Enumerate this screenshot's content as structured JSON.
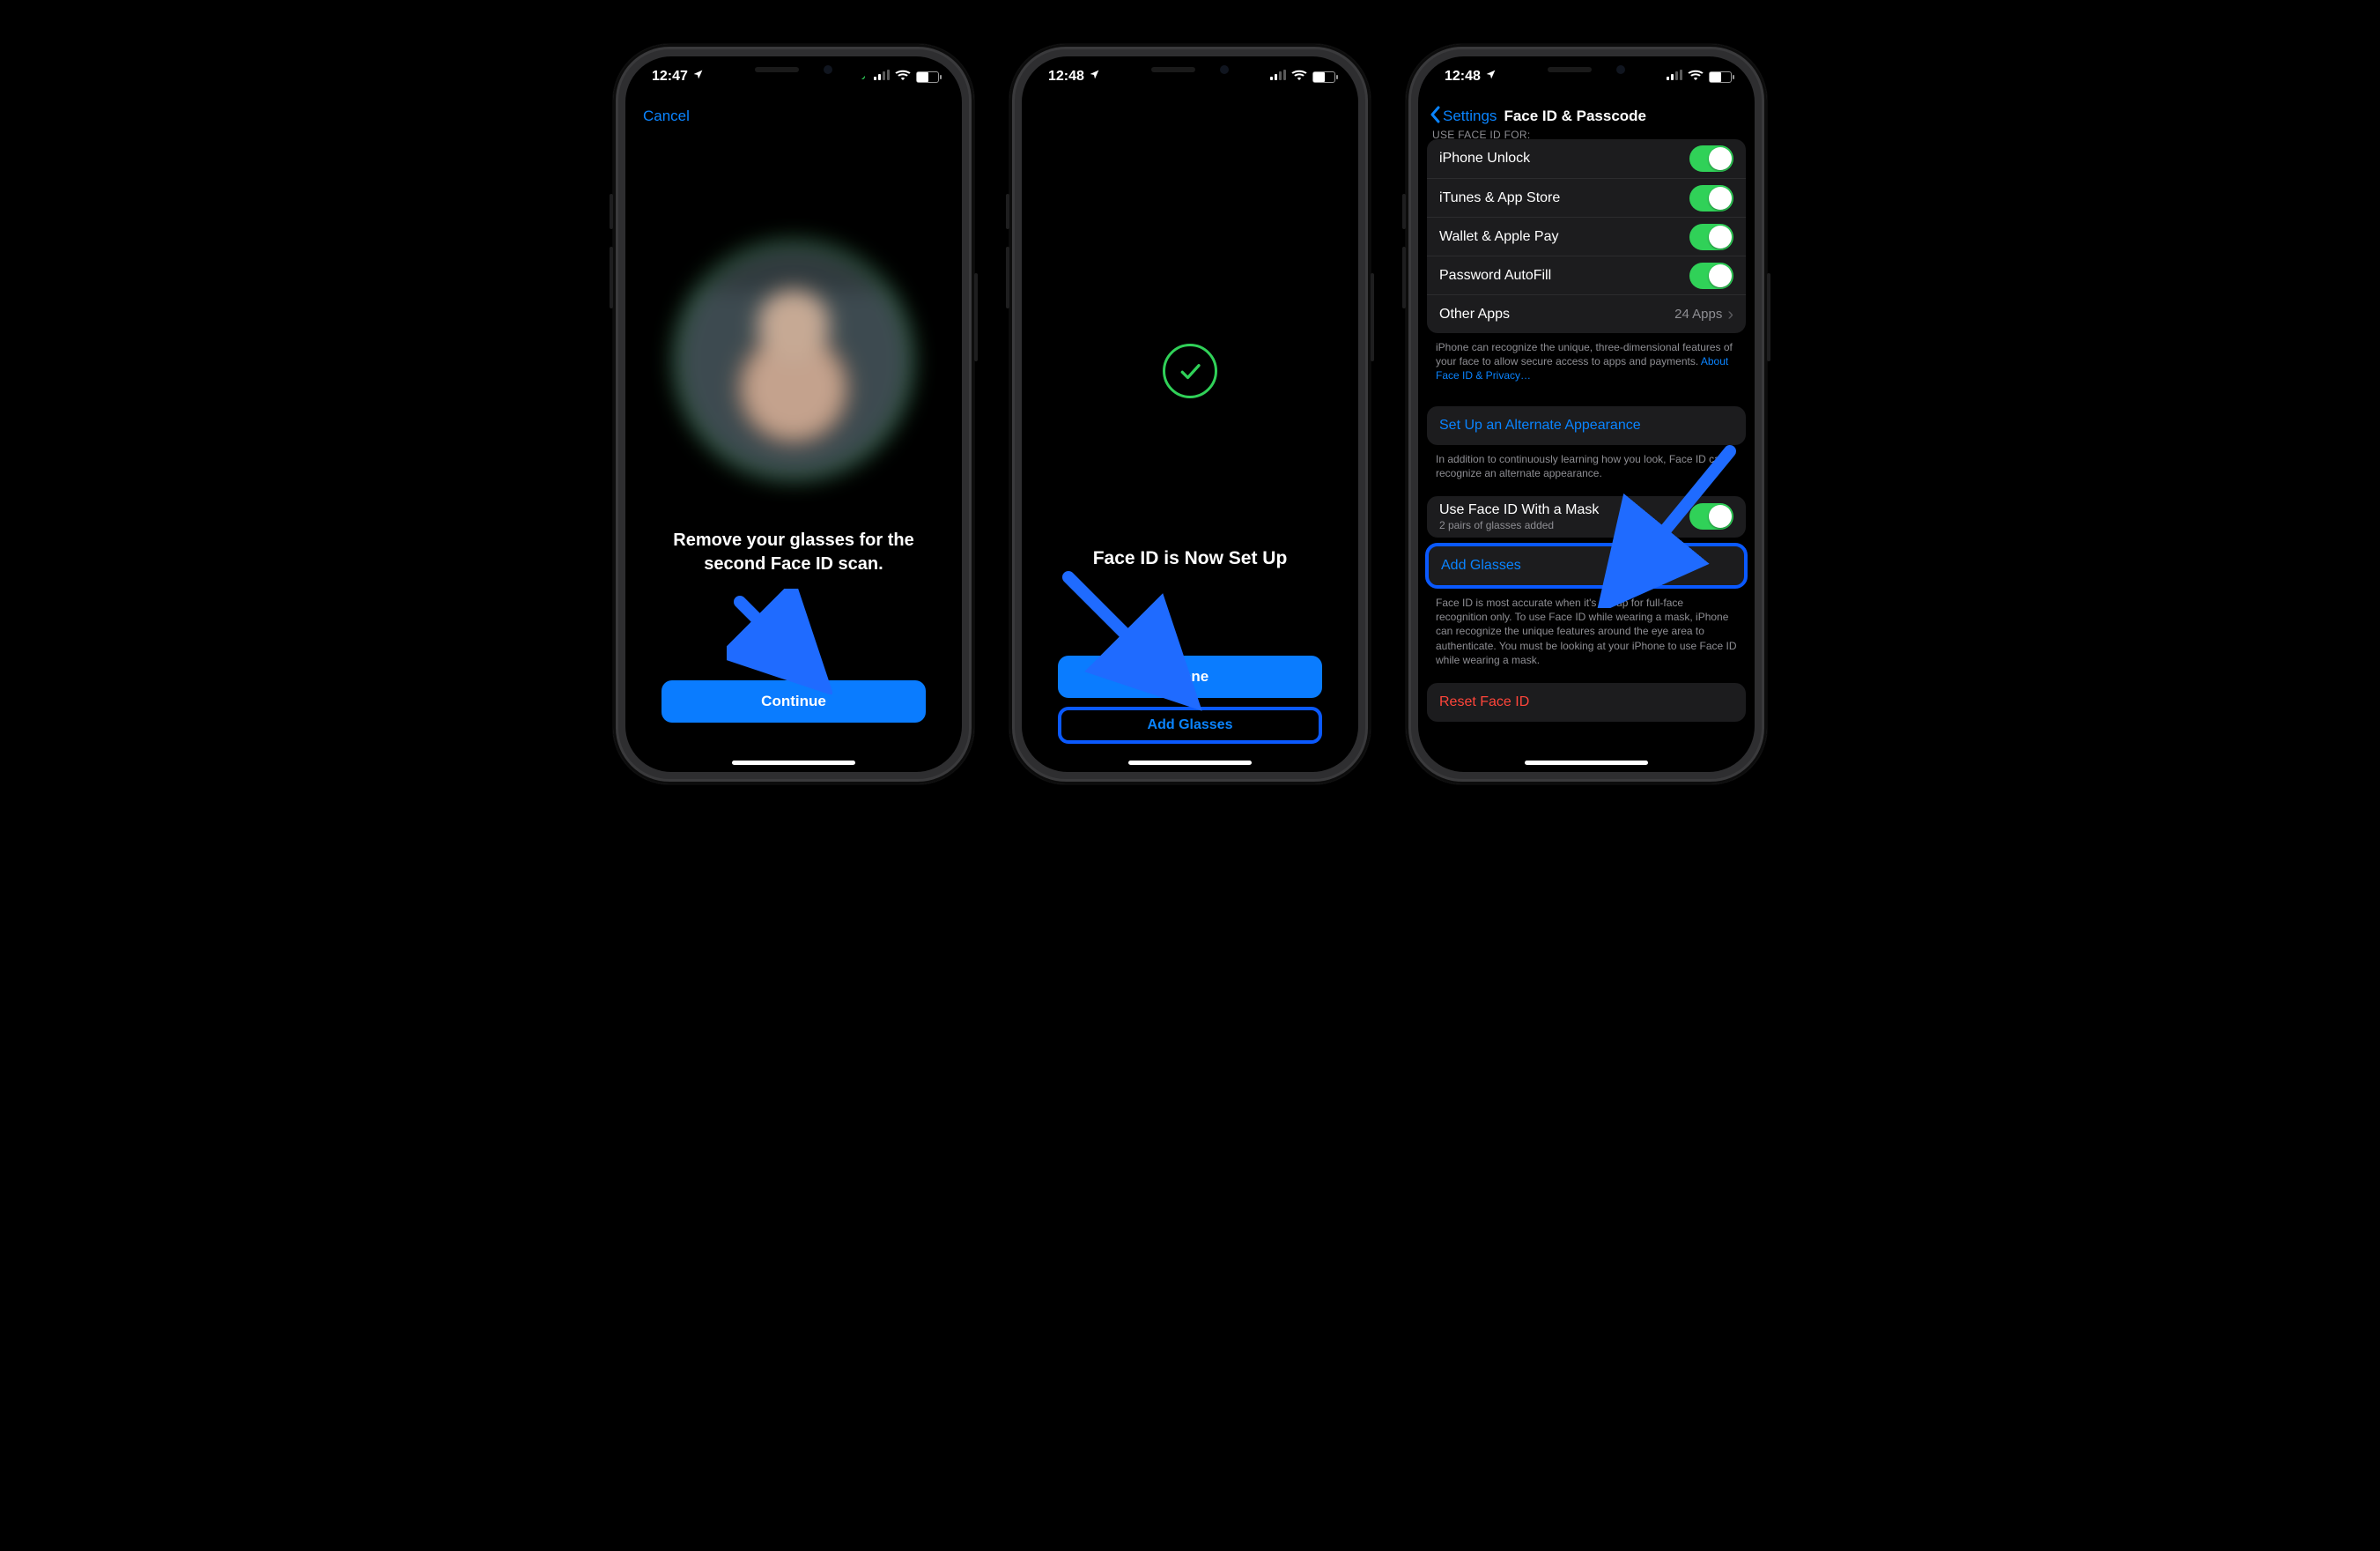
{
  "screen1": {
    "time": "12:47",
    "cancel": "Cancel",
    "prompt_line1": "Remove your glasses for the",
    "prompt_line2": "second Face ID scan.",
    "continue": "Continue"
  },
  "screen2": {
    "time": "12:48",
    "title": "Face ID is Now Set Up",
    "done": "Done",
    "add_glasses": "Add Glasses"
  },
  "screen3": {
    "time": "12:48",
    "back_label": "Settings",
    "nav_title": "Face ID & Passcode",
    "section_use_faceid": "USE FACE ID FOR:",
    "rows_use": {
      "iphone_unlock": "iPhone Unlock",
      "itunes": "iTunes & App Store",
      "wallet": "Wallet & Apple Pay",
      "autofill": "Password AutoFill",
      "other_apps": "Other Apps",
      "other_apps_trail": "24 Apps"
    },
    "desc1_a": "iPhone can recognize the unique, three-dimensional features of your face to allow secure access to apps and payments. ",
    "desc1_link": "About Face ID & Privacy…",
    "alt_appearance": "Set Up an Alternate Appearance",
    "desc2": "In addition to continuously learning how you look, Face ID can recognize an alternate appearance.",
    "mask_label": "Use Face ID With a Mask",
    "mask_sub": "2 pairs of glasses added",
    "add_glasses": "Add Glasses",
    "desc3": "Face ID is most accurate when it's set up for full-face recognition only. To use Face ID while wearing a mask, iPhone can recognize the unique features around the eye area to authenticate. You must be looking at your iPhone to use Face ID while wearing a mask.",
    "reset": "Reset Face ID"
  }
}
